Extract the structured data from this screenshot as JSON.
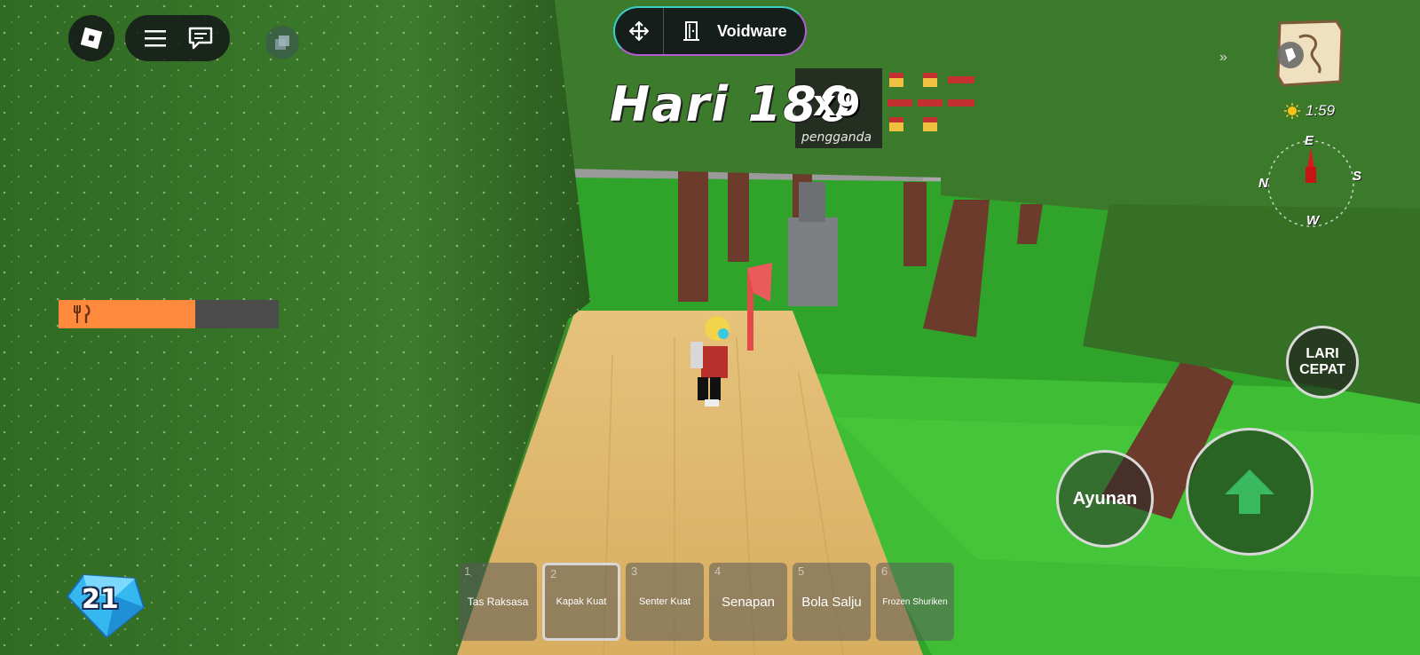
{
  "game": {
    "experience_name": "Voidware",
    "day_counter": "Hari 180",
    "multiplier": "x9",
    "multiplier_label": "pengganda",
    "time": "1:59",
    "compass": {
      "north": "N",
      "east": "E",
      "south": "S",
      "west": "W"
    },
    "hunger_fraction": 0.62,
    "gems": "21"
  },
  "top_left": {
    "icons": [
      "roblox-menu-icon",
      "hamburger-menu-icon",
      "chat-icon",
      "backpack-icon"
    ]
  },
  "actions": {
    "sprint_line1": "LARI",
    "sprint_line2": "CEPAT",
    "swing": "Ayunan"
  },
  "hotbar": [
    {
      "num": "1",
      "label": "Tas Raksasa"
    },
    {
      "num": "2",
      "label": "Kapak Kuat",
      "selected": true
    },
    {
      "num": "3",
      "label": "Senter Kuat"
    },
    {
      "num": "4",
      "label": "Senapan"
    },
    {
      "num": "5",
      "label": "Bola Salju"
    },
    {
      "num": "6",
      "label": "Frozen Shuriken"
    }
  ],
  "colors": {
    "hunger_fill": "#ff8a3d",
    "hud_dark": "#141418",
    "pill_gradient_start": "#3ad0c8",
    "pill_gradient_end": "#b45cd6"
  }
}
